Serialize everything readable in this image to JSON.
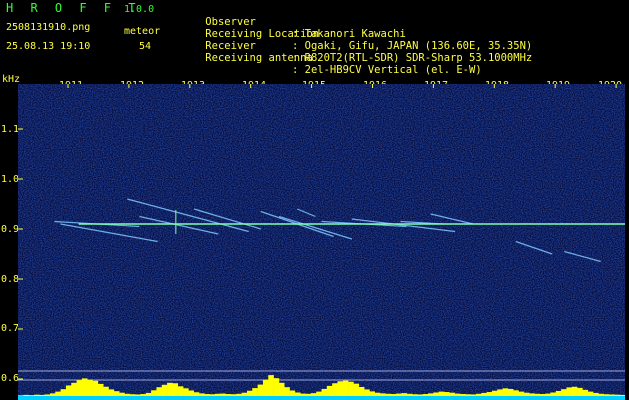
{
  "header": {
    "brand": "H R O F F T",
    "version": "1.0.0",
    "filename": "2508131910.png",
    "meteor_label": "meteor",
    "timestamp": "25.08.13 19:10",
    "meteor_count": "54"
  },
  "info": [
    {
      "label": "Observer",
      "value": ": Takanori Kawachi"
    },
    {
      "label": "Receiving Location",
      "value": ": Ogaki, Gifu, JAPAN (136.60E, 35.35N)"
    },
    {
      "label": "Receiver",
      "value": ": R820T2(RTL-SDR) SDR-Sharp 53.1000MHz"
    },
    {
      "label": "Receiving antenna",
      "value": ": 2el-HB9CV Vertical (el. E-W)"
    }
  ],
  "axes": {
    "unit": "kHz",
    "minute_ticks": [
      "1911",
      "1912",
      "1913",
      "1914",
      "1915",
      "1916",
      "1917",
      "1918",
      "1919",
      "1920"
    ],
    "freq_ticks": [
      "1.1",
      "1.0",
      "0.9",
      "0.8",
      "0.7",
      "0.6"
    ]
  },
  "colors": {
    "text": "#ffff40",
    "brand": "#30ff30",
    "background": "#000000",
    "noise": "#0a1a78",
    "carrier": "#80ffb0",
    "activity_bar": "#ffff00",
    "baseline": "#00d0ff"
  },
  "carrier_khz": 0.91,
  "meteor_traces": [
    {
      "t0": 0.06,
      "f0": 0.915,
      "t1": 0.2,
      "f1": 0.905
    },
    {
      "t0": 0.07,
      "f0": 0.91,
      "t1": 0.23,
      "f1": 0.875
    },
    {
      "t0": 0.18,
      "f0": 0.96,
      "t1": 0.38,
      "f1": 0.895
    },
    {
      "t0": 0.2,
      "f0": 0.925,
      "t1": 0.33,
      "f1": 0.89
    },
    {
      "t0": 0.29,
      "f0": 0.94,
      "t1": 0.4,
      "f1": 0.9
    },
    {
      "t0": 0.4,
      "f0": 0.935,
      "t1": 0.52,
      "f1": 0.885
    },
    {
      "t0": 0.43,
      "f0": 0.925,
      "t1": 0.55,
      "f1": 0.88
    },
    {
      "t0": 0.46,
      "f0": 0.94,
      "t1": 0.49,
      "f1": 0.925
    },
    {
      "t0": 0.5,
      "f0": 0.915,
      "t1": 0.64,
      "f1": 0.905
    },
    {
      "t0": 0.55,
      "f0": 0.92,
      "t1": 0.72,
      "f1": 0.895
    },
    {
      "t0": 0.63,
      "f0": 0.915,
      "t1": 0.7,
      "f1": 0.91
    },
    {
      "t0": 0.68,
      "f0": 0.93,
      "t1": 0.75,
      "f1": 0.91
    },
    {
      "t0": 0.82,
      "f0": 0.875,
      "t1": 0.88,
      "f1": 0.85
    },
    {
      "t0": 0.9,
      "f0": 0.855,
      "t1": 0.96,
      "f1": 0.835
    }
  ],
  "activity": [
    0.3,
    0.5,
    0.4,
    0.6,
    0.5,
    0.7,
    1.2,
    2.0,
    3.1,
    4.8,
    6.0,
    7.2,
    8.0,
    7.4,
    6.9,
    5.5,
    4.2,
    3.0,
    2.2,
    1.5,
    1.0,
    0.8,
    0.7,
    0.9,
    1.4,
    2.6,
    4.0,
    5.1,
    6.0,
    5.8,
    4.4,
    3.5,
    2.5,
    1.7,
    1.2,
    0.9,
    0.8,
    1.0,
    1.1,
    0.9,
    0.8,
    1.0,
    1.5,
    2.4,
    3.6,
    5.2,
    7.4,
    9.5,
    8.1,
    6.0,
    4.0,
    2.5,
    1.6,
    1.1,
    1.0,
    1.3,
    2.0,
    3.2,
    4.6,
    5.8,
    6.7,
    7.0,
    6.5,
    5.6,
    4.1,
    3.0,
    2.1,
    1.5,
    1.2,
    1.0,
    0.9,
    1.1,
    1.3,
    1.0,
    0.8,
    0.7,
    0.9,
    1.2,
    1.6,
    2.0,
    1.8,
    1.5,
    1.1,
    0.9,
    0.8,
    0.7,
    1.0,
    1.4,
    1.8,
    2.4,
    3.0,
    3.5,
    3.2,
    2.6,
    2.0,
    1.5,
    1.2,
    1.0,
    0.9,
    1.1,
    1.6,
    2.3,
    3.1,
    3.9,
    4.2,
    3.7,
    2.8,
    2.0,
    1.4,
    1.0,
    0.8,
    0.7,
    0.6,
    0.5
  ]
}
